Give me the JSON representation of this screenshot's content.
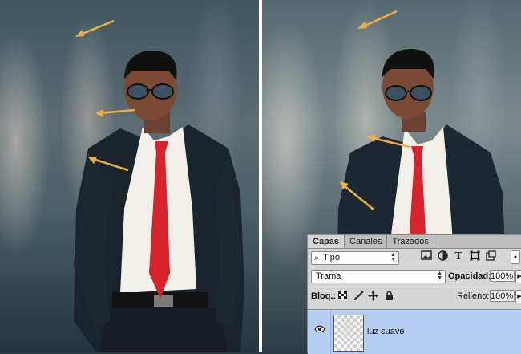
{
  "panel": {
    "tabs": [
      {
        "label": "Capas",
        "active": true
      },
      {
        "label": "Canales",
        "active": false
      },
      {
        "label": "Trazados",
        "active": false
      }
    ],
    "filter": {
      "kind_label": "Tipo"
    },
    "filter_icons": [
      "image-filter-icon",
      "adjustment-filter-icon",
      "type-filter-icon",
      "shape-filter-icon",
      "smart-object-filter-icon"
    ],
    "blend_mode": "Trama",
    "opacity_label": "Opacidad:",
    "opacity_value": "100%",
    "lock_label": "Bloq.:",
    "lock_icons": [
      "lock-transparent-icon",
      "lock-paint-icon",
      "lock-position-icon",
      "lock-all-icon"
    ],
    "fill_label": "Relleno:",
    "fill_value": "100%",
    "layers": [
      {
        "name": "luz suave",
        "visible": true,
        "selected": true
      }
    ]
  },
  "colors": {
    "arrow": "#f0b040",
    "selected_layer": "#b6cdf2",
    "tie": "#d8232a"
  }
}
